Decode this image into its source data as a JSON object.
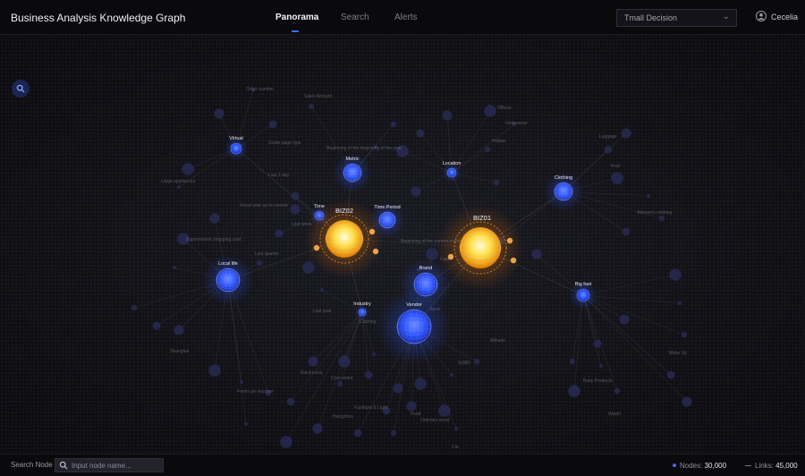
{
  "header": {
    "title": "Business Analysis Knowledge Graph",
    "tabs": [
      {
        "label": "Panorama",
        "active": true
      },
      {
        "label": "Search",
        "active": false
      },
      {
        "label": "Alerts",
        "active": false
      }
    ],
    "dataset_select": "Tmall Decision",
    "user_name": "Cecelia"
  },
  "graph": {
    "major_nodes": [
      {
        "id": "biz02",
        "label": "BIZ02"
      },
      {
        "id": "biz01",
        "label": "BIZ01"
      }
    ],
    "category_nodes": [
      {
        "id": "virtual",
        "label": "Virtual"
      },
      {
        "id": "metric",
        "label": "Metric"
      },
      {
        "id": "location",
        "label": "Location"
      },
      {
        "id": "clothing",
        "label": "Clothing"
      },
      {
        "id": "time",
        "label": "Time"
      },
      {
        "id": "time-period",
        "label": "Time Period"
      },
      {
        "id": "local-life",
        "label": "Local life"
      },
      {
        "id": "brand",
        "label": "Brand"
      },
      {
        "id": "big-fast",
        "label": "Big fast"
      },
      {
        "id": "industry",
        "label": "Industry"
      },
      {
        "id": "vendor",
        "label": "Vendor"
      }
    ],
    "faint_labels": [
      "Order number",
      "Sales Amount",
      "Beginning of the beginning of the year",
      "Guide page type",
      "Last 1 day",
      "Large appliances",
      "Last week",
      "Fiscal year up to current",
      "Supermarket shopping card",
      "Last quarter",
      "Last year",
      "Beginning of the current month · Now",
      "Clothing",
      "Attitude",
      "Electronics",
      "Core event",
      "Furniture & Light",
      "Ordinary wood",
      "Hollow",
      "Women's clothing",
      "Make Up",
      "Baby Products",
      "Watch",
      "Fruit",
      "Luggage",
      "Underwear",
      "Offices",
      "Shanghai",
      "Fresh car voucher",
      "Food",
      "Hangzhou",
      "Car",
      "Cake",
      "Sport",
      "SOBC",
      "Ps"
    ],
    "colors": {
      "major_node": "#ffd23a",
      "major_glow": "#ff8a00",
      "category_node": "#2f5bff",
      "faint_node": "#2b2e5a",
      "edge": "#50505a"
    }
  },
  "controls": {
    "zoom_icon": "search-icon"
  },
  "footer": {
    "search_label": "Search Node",
    "search_placeholder": "Input node name...",
    "nodes_label": "Nodes:",
    "nodes_value": "30,000",
    "links_label": "Links:",
    "links_value": "45,000"
  }
}
